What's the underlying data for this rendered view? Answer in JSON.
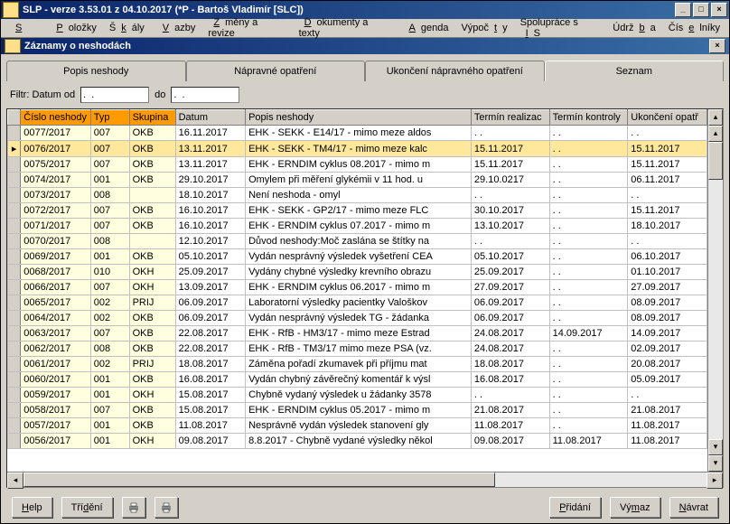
{
  "window": {
    "title": "SLP - verze 3.53.01 z 04.10.2017 (*P - Bartoš Vladimír  [SLC])"
  },
  "menu": {
    "system": "Systém",
    "polozky": "Položky",
    "skaly": "Škály",
    "vazby": "Vazby",
    "zmeny": "Změny a revize",
    "dokumenty": "Dokumenty a texty",
    "agenda": "Agenda",
    "vypocty": "Výpočty",
    "spoluprace": "Spolupráce s IS",
    "udrzba": "Údržba",
    "ciselniky": "Číselníky"
  },
  "panel": {
    "title": "Záznamy o neshodách"
  },
  "tabs": {
    "popis": "Popis neshody",
    "napravne": "Nápravné opatření",
    "ukonceni": "Ukončení nápravného opatření",
    "seznam": "Seznam"
  },
  "filter": {
    "label": "Filtr:  Datum od",
    "from": ".  .",
    "to_label": "do",
    "to": ".  ."
  },
  "columns": {
    "cislo": "Číslo neshody",
    "typ": "Typ",
    "skupina": "Skupina",
    "datum": "Datum",
    "popis": "Popis neshody",
    "term_real": "Termín realizac",
    "term_kontr": "Termín kontroly",
    "ukonceni": "Ukončení opatř"
  },
  "rows": [
    {
      "c": "0077/2017",
      "t": "007",
      "s": "OKB",
      "d": "16.11.2017",
      "p": "EHK - SEKK - E14/17 - mimo meze aldos",
      "tr": ".  .",
      "tk": ".  .",
      "u": ".  ."
    },
    {
      "c": "0076/2017",
      "t": "007",
      "s": "OKB",
      "d": "13.11.2017",
      "p": "EHK - SEKK - TM4/17 - mimo meze kalc",
      "tr": "15.11.2017",
      "tk": ".  .",
      "u": "15.11.2017",
      "sel": true
    },
    {
      "c": "0075/2017",
      "t": "007",
      "s": "OKB",
      "d": "13.11.2017",
      "p": "EHK - ERNDIM cyklus 08.2017 - mimo m",
      "tr": "15.11.2017",
      "tk": ".  .",
      "u": "15.11.2017"
    },
    {
      "c": "0074/2017",
      "t": "001",
      "s": "OKB",
      "d": "29.10.2017",
      "p": "Omylem při měření glykémii v 11 hod. u",
      "tr": "29.10.0217",
      "tk": ".  .",
      "u": "06.11.2017"
    },
    {
      "c": "0073/2017",
      "t": "008",
      "s": "",
      "d": "18.10.2017",
      "p": "Není neshoda - omyl",
      "tr": ".  .",
      "tk": ".  .",
      "u": ".  ."
    },
    {
      "c": "0072/2017",
      "t": "007",
      "s": "OKB",
      "d": "16.10.2017",
      "p": "EHK - SEKK - GP2/17 - mimo meze FLC",
      "tr": "30.10.2017",
      "tk": ".  .",
      "u": "15.11.2017"
    },
    {
      "c": "0071/2017",
      "t": "007",
      "s": "OKB",
      "d": "16.10.2017",
      "p": "EHK - ERNDIM cyklus 07.2017 - mimo m",
      "tr": "13.10.2017",
      "tk": ".  .",
      "u": "18.10.2017"
    },
    {
      "c": "0070/2017",
      "t": "008",
      "s": "",
      "d": "12.10.2017",
      "p": "Důvod neshody:Moč zaslána se štítky na",
      "tr": ".  .",
      "tk": ".  .",
      "u": ".  ."
    },
    {
      "c": "0069/2017",
      "t": "001",
      "s": "OKB",
      "d": "05.10.2017",
      "p": "Vydán nesprávný výsledek vyšetření CEA",
      "tr": "05.10.2017",
      "tk": ".  .",
      "u": "06.10.2017"
    },
    {
      "c": "0068/2017",
      "t": "010",
      "s": "OKH",
      "d": "25.09.2017",
      "p": "Vydány chybné výsledky krevního obrazu",
      "tr": "25.09.2017",
      "tk": ".  .",
      "u": "01.10.2017"
    },
    {
      "c": "0066/2017",
      "t": "007",
      "s": "OKH",
      "d": "13.09.2017",
      "p": "EHK - ERNDIM cyklus 06.2017 - mimo m",
      "tr": "27.09.2017",
      "tk": ".  .",
      "u": "27.09.2017"
    },
    {
      "c": "0065/2017",
      "t": "002",
      "s": "PRIJ",
      "d": "06.09.2017",
      "p": "Laboratorní výsledky pacientky Valoškov",
      "tr": "06.09.2017",
      "tk": ".  .",
      "u": "08.09.2017"
    },
    {
      "c": "0064/2017",
      "t": "002",
      "s": "OKB",
      "d": "06.09.2017",
      "p": "Vydán nesprávný výsledek TG - žádanka",
      "tr": "06.09.2017",
      "tk": ".  .",
      "u": "08.09.2017"
    },
    {
      "c": "0063/2017",
      "t": "007",
      "s": "OKB",
      "d": "22.08.2017",
      "p": "EHK - RfB - HM3/17 - mimo meze Estrad",
      "tr": "24.08.2017",
      "tk": "14.09.2017",
      "u": "14.09.2017"
    },
    {
      "c": "0062/2017",
      "t": "008",
      "s": "OKB",
      "d": "22.08.2017",
      "p": "EHK - RfB - TM3/17 mimo meze PSA (vz.",
      "tr": "24.08.2017",
      "tk": ".  .",
      "u": "02.09.2017"
    },
    {
      "c": "0061/2017",
      "t": "002",
      "s": "PRIJ",
      "d": "18.08.2017",
      "p": "Záměna pořadí zkumavek při příjmu mat",
      "tr": "18.08.2017",
      "tk": ".  .",
      "u": "20.08.2017"
    },
    {
      "c": "0060/2017",
      "t": "001",
      "s": "OKB",
      "d": "16.08.2017",
      "p": "Vydán chybný závěrečný komentář k výsl",
      "tr": "16.08.2017",
      "tk": ".  .",
      "u": "05.09.2017"
    },
    {
      "c": "0059/2017",
      "t": "001",
      "s": "OKH",
      "d": "15.08.2017",
      "p": "Chybně vydaný výsledek u žádanky 3578",
      "tr": ".  .",
      "tk": ".  .",
      "u": ".  ."
    },
    {
      "c": "0058/2017",
      "t": "007",
      "s": "OKB",
      "d": "15.08.2017",
      "p": "EHK - ERNDIM cyklus 05.2017 - mimo m",
      "tr": "21.08.2017",
      "tk": ".  .",
      "u": "21.08.2017"
    },
    {
      "c": "0057/2017",
      "t": "001",
      "s": "OKB",
      "d": "11.08.2017",
      "p": "Nesprávně vydán výsledek stanovení gly",
      "tr": "11.08.2017",
      "tk": ".  .",
      "u": "11.08.2017"
    },
    {
      "c": "0056/2017",
      "t": "001",
      "s": "OKH",
      "d": "09.08.2017",
      "p": "8.8.2017 - Chybně vydané výsledky někol",
      "tr": "09.08.2017",
      "tk": "11.08.2017",
      "u": "11.08.2017"
    }
  ],
  "buttons": {
    "help": "Help",
    "trideni": "Třídění",
    "pridani": "Přidání",
    "vymaz": "Výmaz",
    "navrat": "Návrat"
  }
}
